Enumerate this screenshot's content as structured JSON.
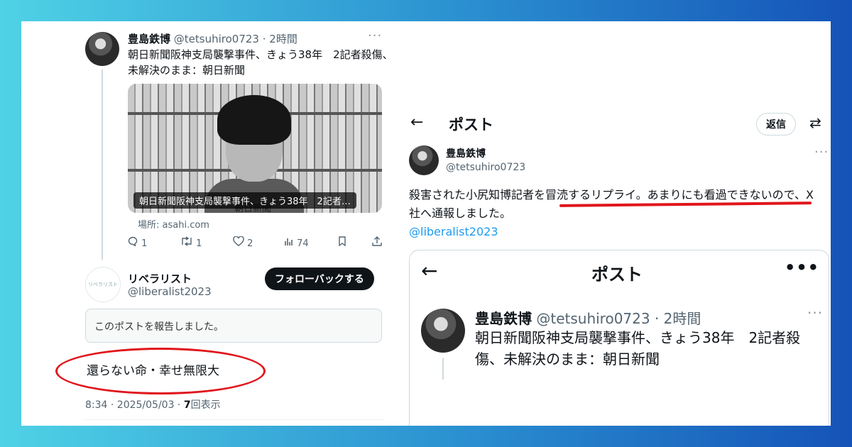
{
  "left": {
    "tweet": {
      "name": "豊島鉄博",
      "meta": "@tetsuhiro0723 · 2時間",
      "more": "···",
      "text": "朝日新聞阪神支局襲撃事件、きょう38年　2記者殺傷、未解決のまま：朝日新聞",
      "photo_caption": "朝日新聞阪神支局襲撃事件、きょう38年　2記者…",
      "photo_caption2": "朝日新聞",
      "source": "場所: asahi.com",
      "actions": {
        "replies": "1",
        "retweets": "1",
        "likes": "2",
        "views": "74"
      }
    },
    "reply": {
      "avatar_text": "リベラリスト",
      "name": "リベラリスト",
      "handle": "@liberalist2023",
      "follow_back": "フォローバックする",
      "reported_notice": "このポストを報告しました。",
      "text": "還らない命・幸せ無限大",
      "stamp_time": "8:34 · 2025/05/03 · ",
      "stamp_views": "7",
      "stamp_suffix": "回表示"
    }
  },
  "right": {
    "header": {
      "back": "←",
      "title": "ポスト",
      "reply_button": "返信",
      "settings_icon": "⇄"
    },
    "post": {
      "name": "豊島鉄博",
      "handle": "@tetsuhiro0723",
      "more": "···",
      "body": "殺害された小尻知博記者を冒涜するリプライ。あまりにも看過できないので、X社へ通報しました。",
      "mention": "@liberalist2023"
    },
    "embedded": {
      "back": "←",
      "title": "ポスト",
      "more": "•••",
      "name": "豊島鉄博",
      "meta": "@tetsuhiro0723 · 2時間",
      "more2": "···",
      "text": "朝日新聞阪神支局襲撃事件、きょう38年　2記者殺傷、未解決のまま：朝日新聞"
    }
  },
  "colors": {
    "highlight_red": "#e0161c",
    "link_blue": "#1d9bf0"
  }
}
